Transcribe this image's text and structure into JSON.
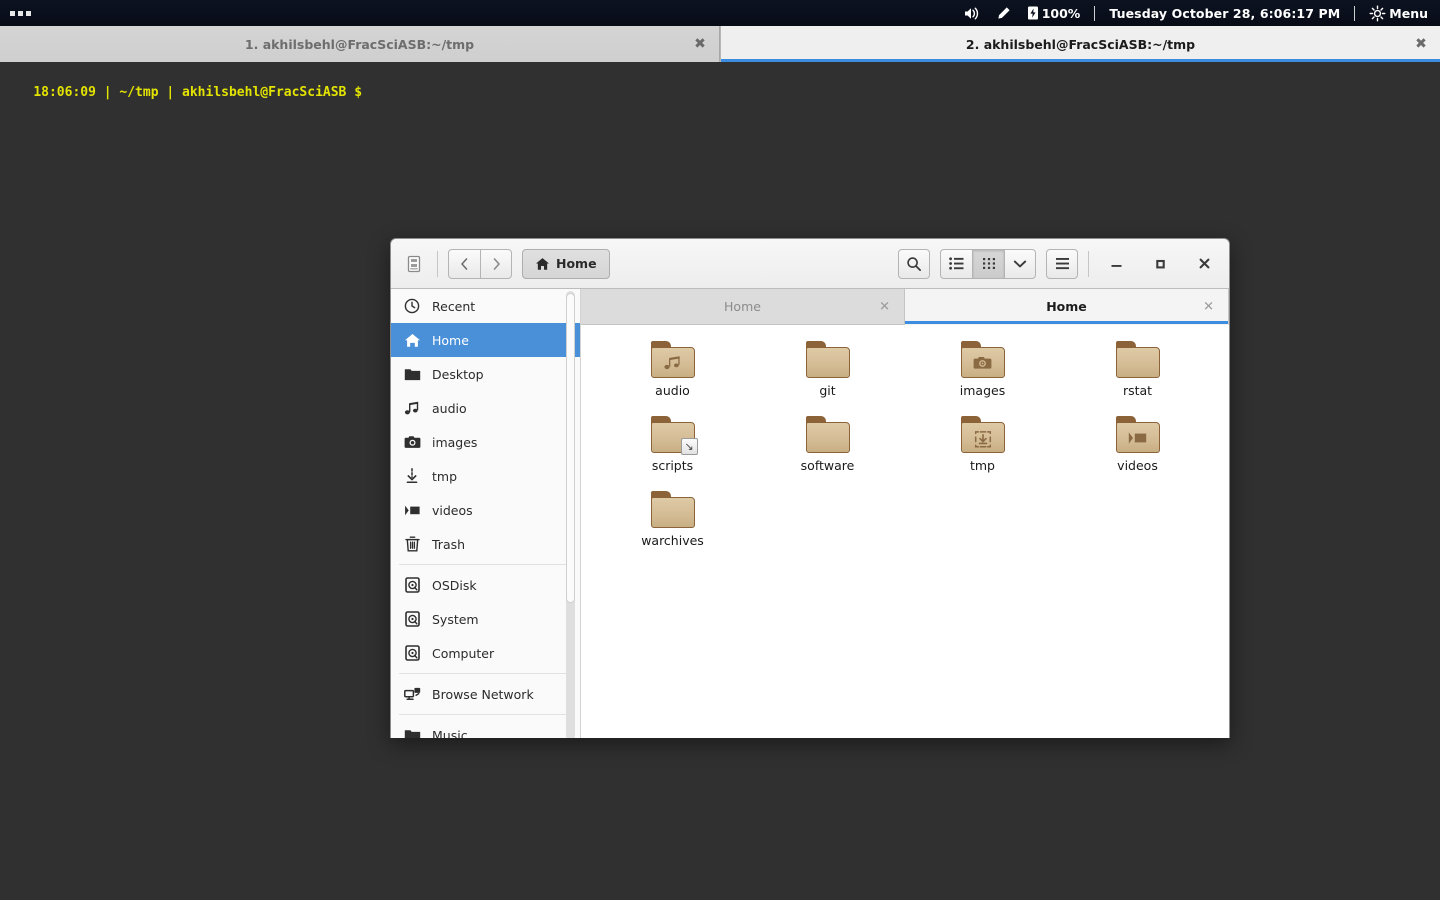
{
  "panel": {
    "dots_icon": "three-dots-icon",
    "tray": {
      "volume_icon": "volume-icon",
      "bluetooth_icon": "pen-icon",
      "battery_icon": "battery-icon",
      "battery_percent": "100%",
      "clock": "Tuesday October 28,  6:06:17 PM",
      "settings_icon": "gear-icon",
      "menu_label": "Menu"
    }
  },
  "terminal": {
    "tabs": [
      {
        "label": "1. akhilsbehl@FracSciASB:~/tmp",
        "active": false,
        "close_icon": "close-icon"
      },
      {
        "label": "2. akhilsbehl@FracSciASB:~/tmp",
        "active": true,
        "close_icon": "close-icon"
      }
    ],
    "prompt": "18:06:09 | ~/tmp | akhilsbehl@FracSciASB $",
    "bg_color": "#303030",
    "fg_color": "#e3e300"
  },
  "filemanager": {
    "toolbar": {
      "sidebar_toggle_icon": "sidebar-toggle-icon",
      "back_icon": "chevron-left-icon",
      "forward_icon": "chevron-right-icon",
      "breadcrumb_home_icon": "home-icon",
      "breadcrumb_home_label": "Home",
      "search_icon": "search-icon",
      "list_view_icon": "list-view-icon",
      "grid_view_icon": "grid-view-icon",
      "view_options_icon": "chevron-down-icon",
      "menu_icon": "hamburger-menu-icon",
      "minimize_icon": "minimize-icon",
      "maximize_icon": "maximize-icon",
      "close_icon": "close-icon"
    },
    "sidebar": {
      "items": [
        {
          "label": "Recent",
          "icon": "clock-icon",
          "selected": false,
          "sep_after": false
        },
        {
          "label": "Home",
          "icon": "home-icon",
          "selected": true,
          "sep_after": false
        },
        {
          "label": "Desktop",
          "icon": "folder-icon",
          "selected": false,
          "sep_after": false
        },
        {
          "label": "audio",
          "icon": "music-icon",
          "selected": false,
          "sep_after": false
        },
        {
          "label": "images",
          "icon": "camera-icon",
          "selected": false,
          "sep_after": false
        },
        {
          "label": "tmp",
          "icon": "download-icon",
          "selected": false,
          "sep_after": false
        },
        {
          "label": "videos",
          "icon": "video-icon",
          "selected": false,
          "sep_after": false
        },
        {
          "label": "Trash",
          "icon": "trash-icon",
          "selected": false,
          "sep_after": true
        },
        {
          "label": "OSDisk",
          "icon": "drive-icon",
          "selected": false,
          "sep_after": false
        },
        {
          "label": "System",
          "icon": "drive-icon",
          "selected": false,
          "sep_after": false
        },
        {
          "label": "Computer",
          "icon": "drive-icon",
          "selected": false,
          "sep_after": true
        },
        {
          "label": "Browse Network",
          "icon": "network-icon",
          "selected": false,
          "sep_after": true
        },
        {
          "label": "Music",
          "icon": "folder-icon",
          "selected": false,
          "sep_after": false
        }
      ],
      "selection_color": "#4a90d9"
    },
    "tabs": [
      {
        "label": "Home",
        "active": false,
        "close_icon": "close-icon"
      },
      {
        "label": "Home",
        "active": true,
        "close_icon": "close-icon"
      }
    ],
    "files": [
      {
        "name": "audio",
        "type": "folder",
        "emblem": "music-emblem",
        "symlink": false
      },
      {
        "name": "git",
        "type": "folder",
        "emblem": "none",
        "symlink": false
      },
      {
        "name": "images",
        "type": "folder",
        "emblem": "camera-emblem",
        "symlink": false
      },
      {
        "name": "rstat",
        "type": "folder",
        "emblem": "none",
        "symlink": false
      },
      {
        "name": "scripts",
        "type": "folder",
        "emblem": "none",
        "symlink": true
      },
      {
        "name": "software",
        "type": "folder",
        "emblem": "none",
        "symlink": false
      },
      {
        "name": "tmp",
        "type": "folder",
        "emblem": "download-emblem",
        "symlink": false
      },
      {
        "name": "videos",
        "type": "folder",
        "emblem": "video-emblem",
        "symlink": false
      },
      {
        "name": "warchives",
        "type": "folder",
        "emblem": "none",
        "symlink": false
      }
    ]
  }
}
